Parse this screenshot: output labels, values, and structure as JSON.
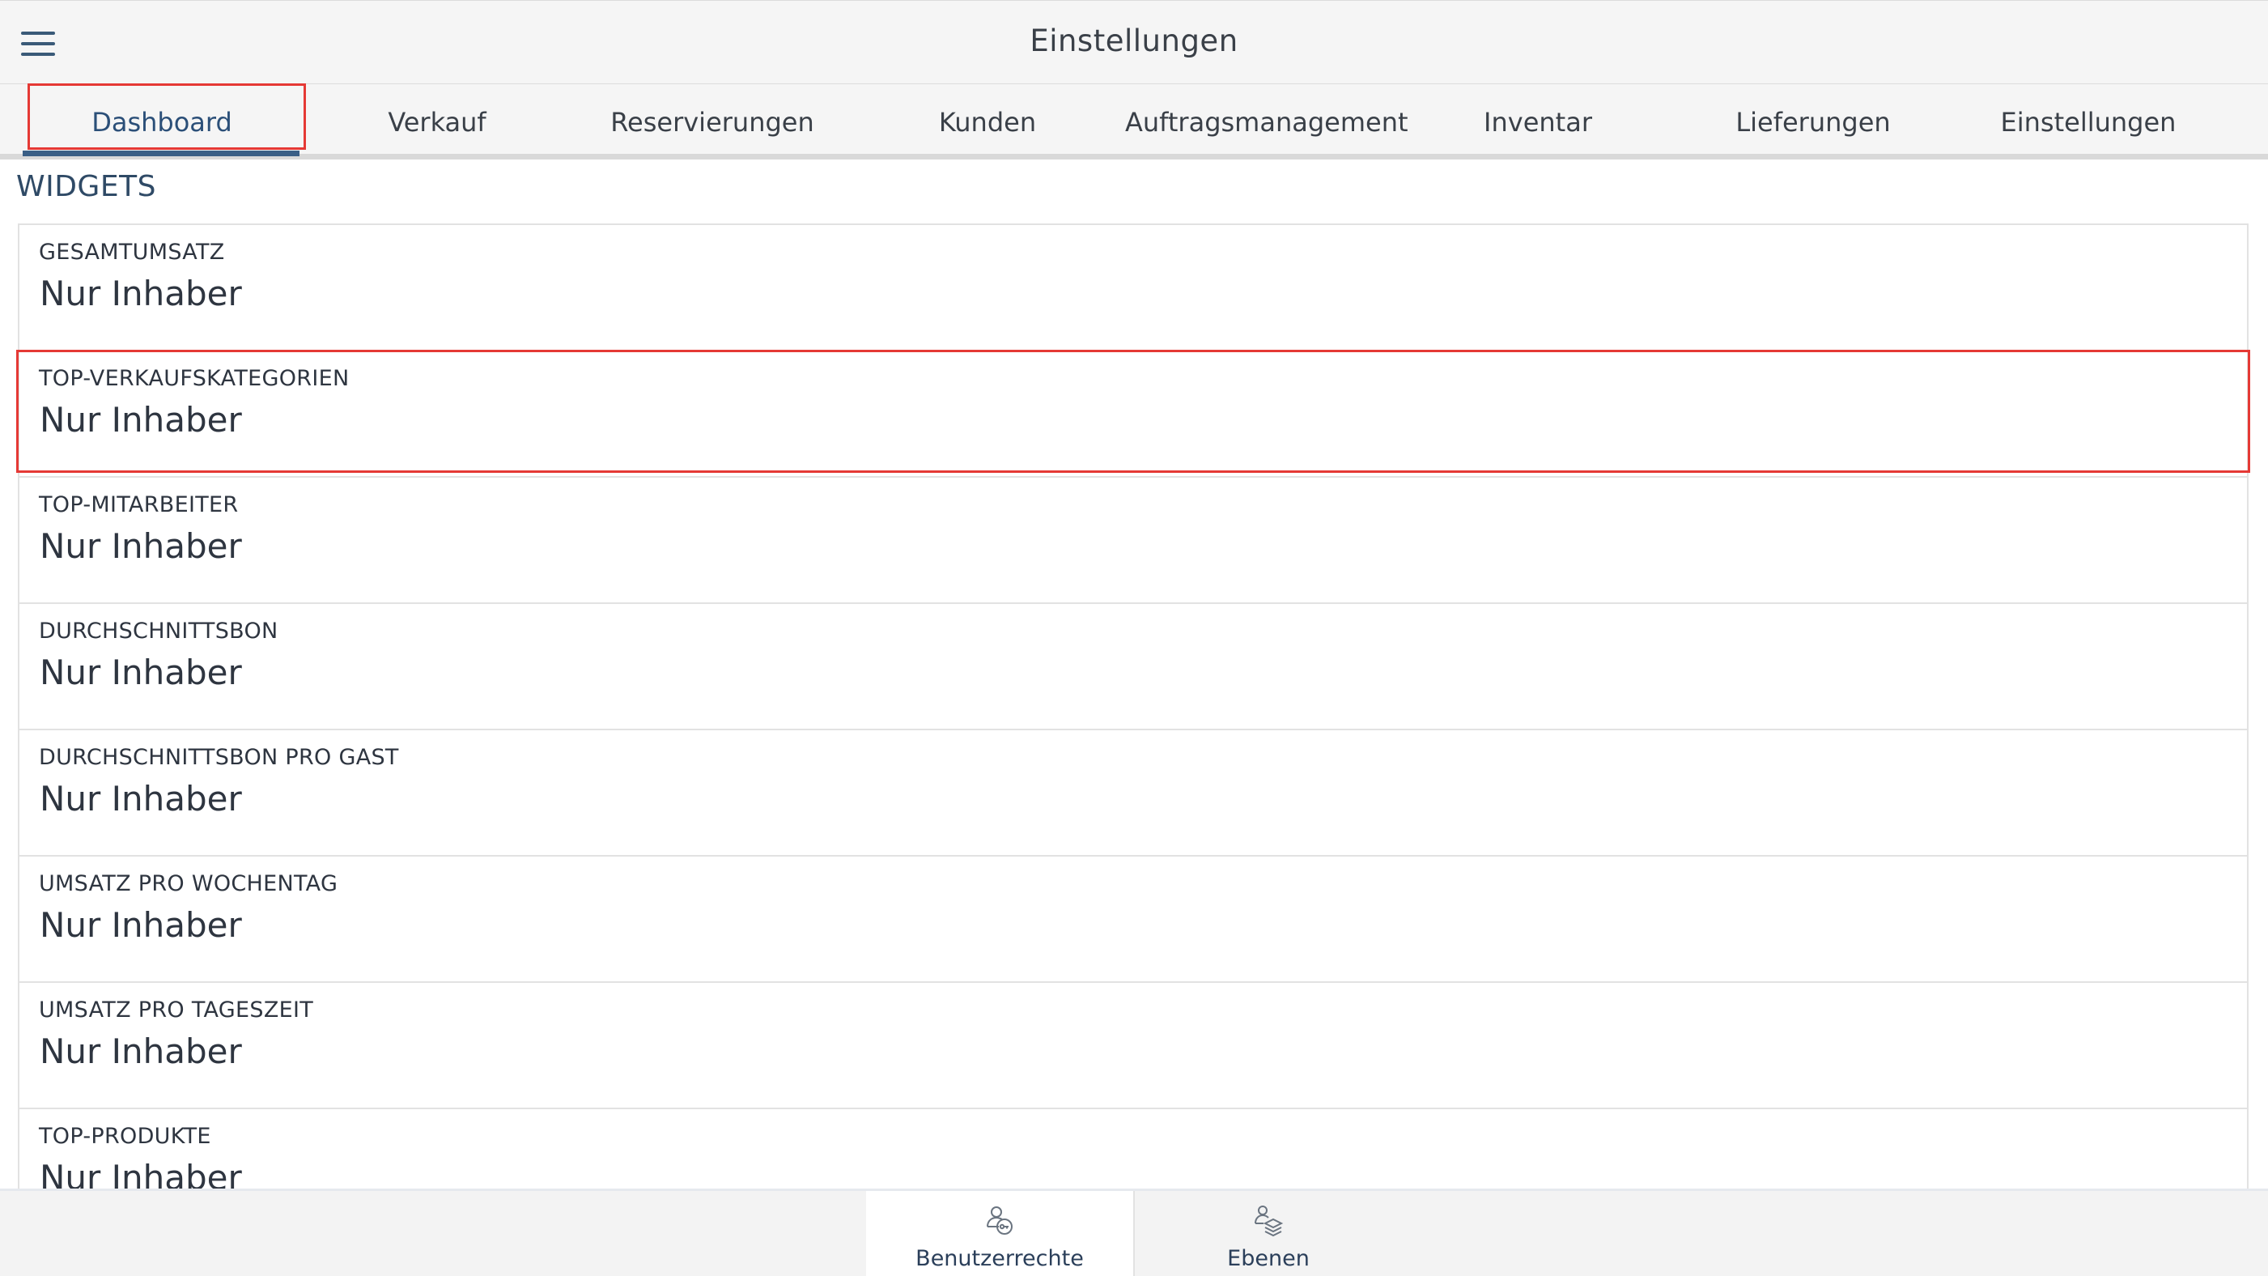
{
  "header": {
    "title": "Einstellungen",
    "menu_icon": "hamburger-menu-icon"
  },
  "tabs": [
    {
      "label": "Dashboard",
      "active": true
    },
    {
      "label": "Verkauf"
    },
    {
      "label": "Reservierungen"
    },
    {
      "label": "Kunden"
    },
    {
      "label": "Auftragsmanagement"
    },
    {
      "label": "Inventar"
    },
    {
      "label": "Lieferungen"
    },
    {
      "label": "Einstellungen"
    }
  ],
  "section": {
    "title": "WIDGETS"
  },
  "widgets": [
    {
      "label": "GESAMTUMSATZ",
      "value": "Nur Inhaber"
    },
    {
      "label": "TOP-VERKAUFSKATEGORIEN",
      "value": "Nur Inhaber"
    },
    {
      "label": "TOP-MITARBEITER",
      "value": "Nur Inhaber"
    },
    {
      "label": "DURCHSCHNITTSBON",
      "value": "Nur Inhaber"
    },
    {
      "label": "DURCHSCHNITTSBON PRO GAST",
      "value": "Nur Inhaber"
    },
    {
      "label": "UMSATZ PRO WOCHENTAG",
      "value": "Nur Inhaber"
    },
    {
      "label": "UMSATZ PRO TAGESZEIT",
      "value": "Nur Inhaber"
    },
    {
      "label": "TOP-PRODUKTE",
      "value": "Nur Inhaber"
    }
  ],
  "bottom_nav": [
    {
      "label": "Benutzerrechte",
      "icon": "user-key-icon",
      "active": true
    },
    {
      "label": "Ebenen",
      "icon": "users-layers-icon",
      "active": false
    }
  ],
  "colors": {
    "accent": "#3a5f86",
    "highlight": "#e53935",
    "text": "#2e3540"
  }
}
